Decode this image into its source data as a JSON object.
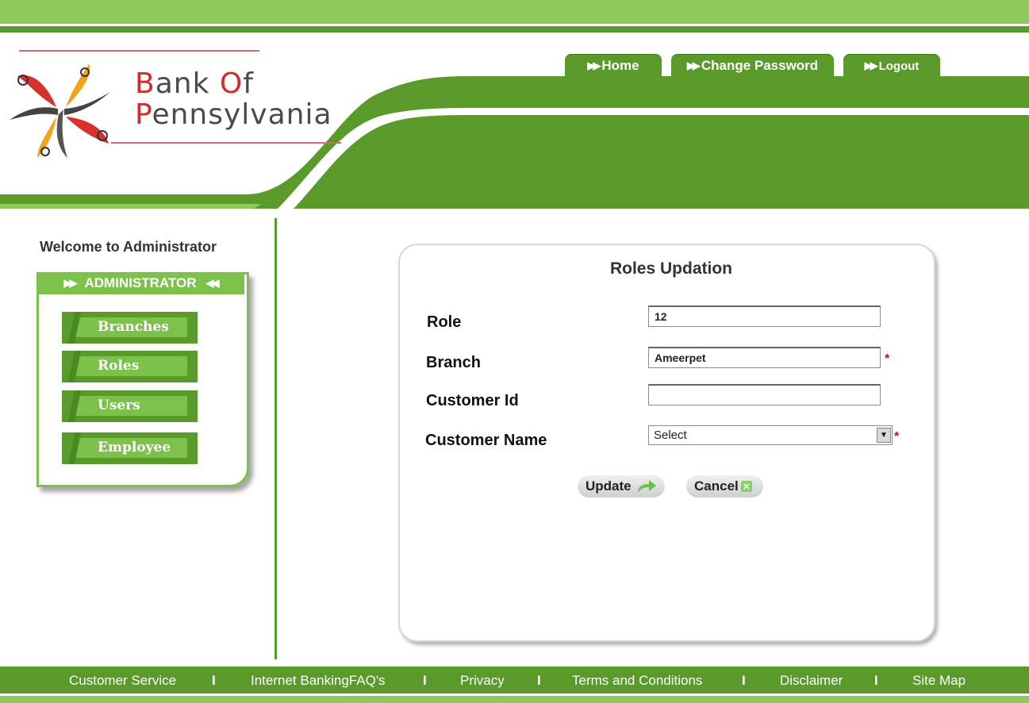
{
  "brand": {
    "line1_prefix": "B",
    "line1_rest": "ank ",
    "line1_o": "O",
    "line1_f": "f",
    "line2_prefix": "P",
    "line2_rest": "ennsylvania",
    "colors": {
      "green_dark": "#5a9a2a",
      "green_light": "#8cc85a",
      "red": "#d42b2b"
    }
  },
  "nav": [
    {
      "label": "Home"
    },
    {
      "label": "Change Password"
    },
    {
      "label": "Logout"
    }
  ],
  "sidebar": {
    "welcome": "Welcome to Administrator",
    "header": "ADMINISTRATOR",
    "items": [
      {
        "label": "Branches"
      },
      {
        "label": "Roles"
      },
      {
        "label": "Users"
      },
      {
        "label": "Employee"
      }
    ]
  },
  "form": {
    "title": "Roles Updation",
    "fields": {
      "role": {
        "label": "Role",
        "value": "12"
      },
      "branch": {
        "label": "Branch",
        "value": "Ameerpet"
      },
      "customer_id": {
        "label": "Customer Id",
        "value": ""
      },
      "customer_name": {
        "label": "Customer Name",
        "selected": "Select"
      }
    },
    "required_mark": "*",
    "update_label": "Update",
    "cancel_label": "Cancel"
  },
  "footer": {
    "links": [
      {
        "label": "Customer Service"
      },
      {
        "label": "Internet BankingFAQ's"
      },
      {
        "label": "Privacy"
      },
      {
        "label": "Terms and Conditions"
      },
      {
        "label": "Disclaimer"
      },
      {
        "label": "Site Map"
      }
    ],
    "separator": "I"
  }
}
